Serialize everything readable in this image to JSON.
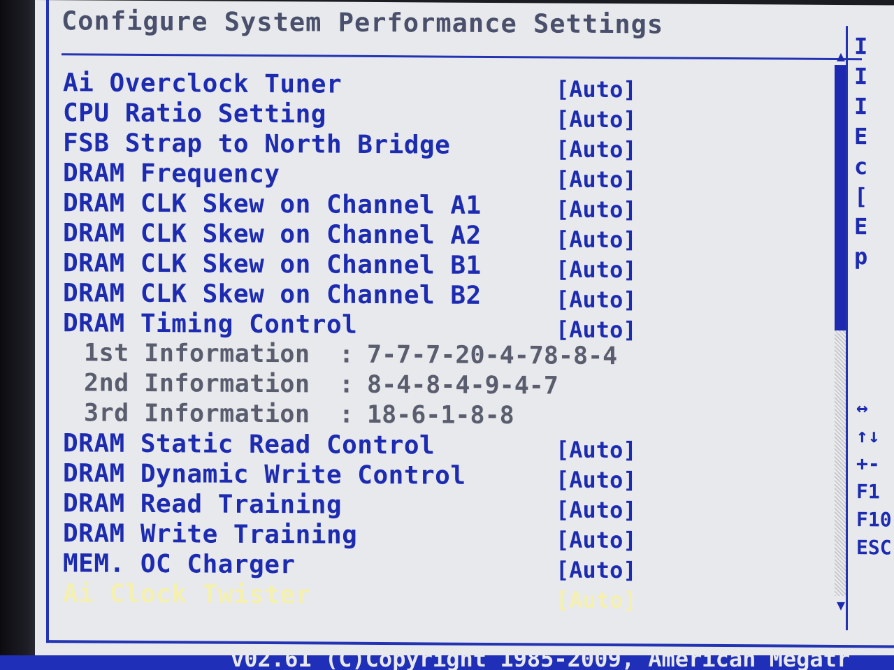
{
  "page": {
    "title": "Configure System Performance Settings"
  },
  "settings": [
    {
      "label": "Ai Overclock Tuner",
      "value": "[Auto]"
    },
    {
      "label": "CPU Ratio Setting",
      "value": "[Auto]"
    },
    {
      "label": "FSB Strap to North Bridge",
      "value": "[Auto]"
    },
    {
      "label": "DRAM Frequency",
      "value": "[Auto]"
    },
    {
      "label": "DRAM CLK Skew on Channel A1",
      "value": "[Auto]"
    },
    {
      "label": "DRAM CLK Skew on Channel A2",
      "value": "[Auto]"
    },
    {
      "label": "DRAM CLK Skew on Channel B1",
      "value": "[Auto]"
    },
    {
      "label": "DRAM CLK Skew on Channel B2",
      "value": "[Auto]"
    },
    {
      "label": "DRAM Timing Control",
      "value": "[Auto]"
    }
  ],
  "info": [
    {
      "label": "1st Information",
      "sep": ":",
      "value": "7-7-7-20-4-78-8-4"
    },
    {
      "label": "2nd Information",
      "sep": ":",
      "value": "8-4-8-4-9-4-7"
    },
    {
      "label": "3rd Information",
      "sep": ":",
      "value": "18-6-1-8-8"
    }
  ],
  "settings2": [
    {
      "label": "DRAM Static Read Control",
      "value": "[Auto]"
    },
    {
      "label": "DRAM Dynamic Write Control",
      "value": "[Auto]"
    },
    {
      "label": "DRAM Read Training",
      "value": "[Auto]"
    },
    {
      "label": "DRAM Write Training",
      "value": "[Auto]"
    },
    {
      "label": "MEM. OC Charger",
      "value": "[Auto]"
    },
    {
      "label": "Ai Clock Twister",
      "value": "[Auto]"
    }
  ],
  "scrollbar": {
    "up_glyph": "▲",
    "down_glyph": "▼"
  },
  "help": [
    "I",
    "I",
    "I",
    "E",
    "c",
    "[",
    "E",
    "p"
  ],
  "keys": [
    "↔",
    "↑↓",
    "+-",
    "F1",
    "F10",
    "ESC"
  ],
  "footer": {
    "text": "v02.61 (C)Copyright 1985-2009, American Megatr"
  },
  "colors": {
    "background": "#e8e9ec",
    "text_blue": "#1c2bb0",
    "info_gray": "#5a5d6e",
    "highlight": "#f4f0b0",
    "footer_bar": "#1f2fb8"
  }
}
